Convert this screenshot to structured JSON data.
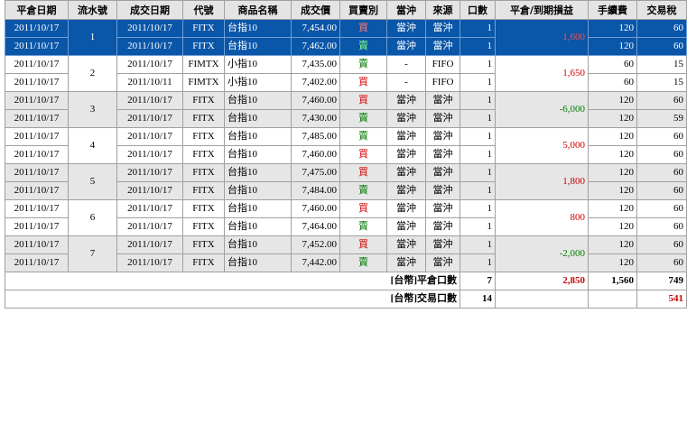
{
  "headers": {
    "close_date": "平倉日期",
    "serial": "流水號",
    "trade_date": "成交日期",
    "code": "代號",
    "product": "商品名稱",
    "price": "成交價",
    "side": "買賣別",
    "daytrade": "當沖",
    "source": "來源",
    "qty": "口數",
    "pnl": "平倉/到期損益",
    "fee": "手續費",
    "tax": "交易稅"
  },
  "groups": [
    {
      "serial": "1",
      "pnl": "1,600",
      "pnl_sign": "pos",
      "selected": true,
      "alt": false,
      "rows": [
        {
          "close_date": "2011/10/17",
          "trade_date": "2011/10/17",
          "code": "FITX",
          "product": "台指10",
          "price": "7,454.00",
          "side": "買",
          "side_type": "buy",
          "daytrade": "當沖",
          "source": "當沖",
          "qty": "1",
          "fee": "120",
          "tax": "60"
        },
        {
          "close_date": "2011/10/17",
          "trade_date": "2011/10/17",
          "code": "FITX",
          "product": "台指10",
          "price": "7,462.00",
          "side": "賣",
          "side_type": "sell",
          "daytrade": "當沖",
          "source": "當沖",
          "qty": "1",
          "fee": "120",
          "tax": "60"
        }
      ]
    },
    {
      "serial": "2",
      "pnl": "1,650",
      "pnl_sign": "pos",
      "selected": false,
      "alt": false,
      "rows": [
        {
          "close_date": "2011/10/17",
          "trade_date": "2011/10/17",
          "code": "FIMTX",
          "product": "小指10",
          "price": "7,435.00",
          "side": "賣",
          "side_type": "sell",
          "daytrade": "-",
          "source": "FIFO",
          "qty": "1",
          "fee": "60",
          "tax": "15"
        },
        {
          "close_date": "2011/10/17",
          "trade_date": "2011/10/11",
          "code": "FIMTX",
          "product": "小指10",
          "price": "7,402.00",
          "side": "買",
          "side_type": "buy",
          "daytrade": "-",
          "source": "FIFO",
          "qty": "1",
          "fee": "60",
          "tax": "15"
        }
      ]
    },
    {
      "serial": "3",
      "pnl": "-6,000",
      "pnl_sign": "neg",
      "selected": false,
      "alt": true,
      "rows": [
        {
          "close_date": "2011/10/17",
          "trade_date": "2011/10/17",
          "code": "FITX",
          "product": "台指10",
          "price": "7,460.00",
          "side": "買",
          "side_type": "buy",
          "daytrade": "當沖",
          "source": "當沖",
          "qty": "1",
          "fee": "120",
          "tax": "60"
        },
        {
          "close_date": "2011/10/17",
          "trade_date": "2011/10/17",
          "code": "FITX",
          "product": "台指10",
          "price": "7,430.00",
          "side": "賣",
          "side_type": "sell",
          "daytrade": "當沖",
          "source": "當沖",
          "qty": "1",
          "fee": "120",
          "tax": "59"
        }
      ]
    },
    {
      "serial": "4",
      "pnl": "5,000",
      "pnl_sign": "pos",
      "selected": false,
      "alt": false,
      "rows": [
        {
          "close_date": "2011/10/17",
          "trade_date": "2011/10/17",
          "code": "FITX",
          "product": "台指10",
          "price": "7,485.00",
          "side": "賣",
          "side_type": "sell",
          "daytrade": "當沖",
          "source": "當沖",
          "qty": "1",
          "fee": "120",
          "tax": "60"
        },
        {
          "close_date": "2011/10/17",
          "trade_date": "2011/10/17",
          "code": "FITX",
          "product": "台指10",
          "price": "7,460.00",
          "side": "買",
          "side_type": "buy",
          "daytrade": "當沖",
          "source": "當沖",
          "qty": "1",
          "fee": "120",
          "tax": "60"
        }
      ]
    },
    {
      "serial": "5",
      "pnl": "1,800",
      "pnl_sign": "pos",
      "selected": false,
      "alt": true,
      "rows": [
        {
          "close_date": "2011/10/17",
          "trade_date": "2011/10/17",
          "code": "FITX",
          "product": "台指10",
          "price": "7,475.00",
          "side": "買",
          "side_type": "buy",
          "daytrade": "當沖",
          "source": "當沖",
          "qty": "1",
          "fee": "120",
          "tax": "60"
        },
        {
          "close_date": "2011/10/17",
          "trade_date": "2011/10/17",
          "code": "FITX",
          "product": "台指10",
          "price": "7,484.00",
          "side": "賣",
          "side_type": "sell",
          "daytrade": "當沖",
          "source": "當沖",
          "qty": "1",
          "fee": "120",
          "tax": "60"
        }
      ]
    },
    {
      "serial": "6",
      "pnl": "800",
      "pnl_sign": "pos",
      "selected": false,
      "alt": false,
      "rows": [
        {
          "close_date": "2011/10/17",
          "trade_date": "2011/10/17",
          "code": "FITX",
          "product": "台指10",
          "price": "7,460.00",
          "side": "買",
          "side_type": "buy",
          "daytrade": "當沖",
          "source": "當沖",
          "qty": "1",
          "fee": "120",
          "tax": "60"
        },
        {
          "close_date": "2011/10/17",
          "trade_date": "2011/10/17",
          "code": "FITX",
          "product": "台指10",
          "price": "7,464.00",
          "side": "賣",
          "side_type": "sell",
          "daytrade": "當沖",
          "source": "當沖",
          "qty": "1",
          "fee": "120",
          "tax": "60"
        }
      ]
    },
    {
      "serial": "7",
      "pnl": "-2,000",
      "pnl_sign": "neg",
      "selected": false,
      "alt": true,
      "rows": [
        {
          "close_date": "2011/10/17",
          "trade_date": "2011/10/17",
          "code": "FITX",
          "product": "台指10",
          "price": "7,452.00",
          "side": "買",
          "side_type": "buy",
          "daytrade": "當沖",
          "source": "當沖",
          "qty": "1",
          "fee": "120",
          "tax": "60"
        },
        {
          "close_date": "2011/10/17",
          "trade_date": "2011/10/17",
          "code": "FITX",
          "product": "台指10",
          "price": "7,442.00",
          "side": "賣",
          "side_type": "sell",
          "daytrade": "當沖",
          "source": "當沖",
          "qty": "1",
          "fee": "120",
          "tax": "60"
        }
      ]
    }
  ],
  "summary": {
    "close_label": "[台幣]平倉口數",
    "close_qty": "7",
    "total_pnl": "2,850",
    "total_fee": "1,560",
    "total_tax_close": "749",
    "trade_label": "[台幣]交易口數",
    "trade_qty": "14",
    "total_tax_trade": "541"
  }
}
